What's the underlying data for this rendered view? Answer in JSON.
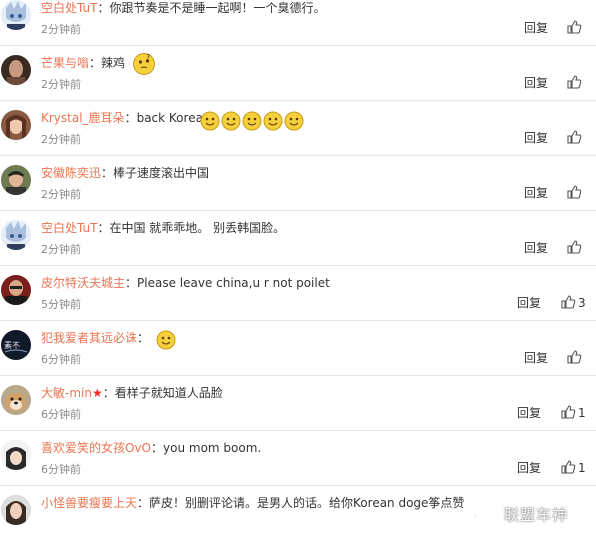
{
  "comments": [
    {
      "user": "空白处TuT",
      "sep": "：",
      "text": "你跟节奏是不是睡一起啊！一个臭德行。",
      "time": "2分钟前",
      "reply": "回复",
      "likes": ""
    },
    {
      "user": "芒果与嗡",
      "sep": "：",
      "text": "辣鸡",
      "time": "2分钟前",
      "reply": "回复",
      "likes": ""
    },
    {
      "user": "Krystal_鹿耳朵",
      "sep": "：",
      "text": "back Korea",
      "time": "2分钟前",
      "reply": "回复",
      "likes": ""
    },
    {
      "user": "安徽陈奕迅",
      "sep": "：",
      "text": "棒子速度滚出中国",
      "time": "2分钟前",
      "reply": "回复",
      "likes": ""
    },
    {
      "user": "空白处TuT",
      "sep": "：",
      "text": "在中国 就乖乖地。 别丢韩国脸。",
      "time": "2分钟前",
      "reply": "回复",
      "likes": ""
    },
    {
      "user": "皮尔特沃夫城主",
      "sep": "：",
      "text": "Please leave china,u r not poilet",
      "time": "5分钟前",
      "reply": "回复",
      "likes": "3"
    },
    {
      "user": "犯我爱者其远必诛",
      "sep": "：",
      "text": "",
      "time": "6分钟前",
      "reply": "回复",
      "likes": ""
    },
    {
      "user": "大敏-min",
      "sep": "：",
      "text": "看样子就知道人品脸",
      "time": "6分钟前",
      "reply": "回复",
      "likes": "1"
    },
    {
      "user": "喜欢爱笑的女孩OvO",
      "sep": "：",
      "text": "you mom boom.",
      "time": "6分钟前",
      "reply": "回复",
      "likes": "1"
    },
    {
      "user": "小怪兽要瘦要上天",
      "sep": "：",
      "text": "萨皮！别删评论请。是男人的话。给你Korean doge筝点赞",
      "time": "",
      "reply": "",
      "likes": ""
    }
  ],
  "watermark": {
    "text": "联盟车神"
  },
  "colors": {
    "username": "#eb7350",
    "text": "#333333",
    "time": "#888888",
    "divider": "#e6e6e6"
  }
}
